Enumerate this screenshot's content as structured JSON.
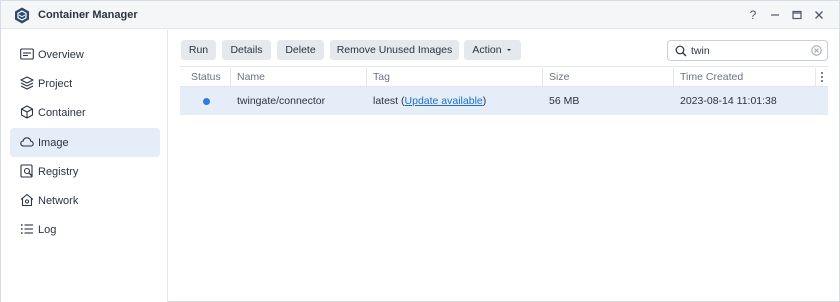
{
  "app": {
    "title": "Container Manager",
    "controls": {
      "help": "?",
      "minimize": "—",
      "maximize": "□",
      "close": "✕"
    }
  },
  "sidebar": {
    "items": [
      {
        "label": "Overview",
        "icon": "overview-icon",
        "active": false
      },
      {
        "label": "Project",
        "icon": "project-icon",
        "active": false
      },
      {
        "label": "Container",
        "icon": "container-icon",
        "active": false
      },
      {
        "label": "Image",
        "icon": "cloud-icon",
        "active": true
      },
      {
        "label": "Registry",
        "icon": "registry-icon",
        "active": false
      },
      {
        "label": "Network",
        "icon": "network-icon",
        "active": false
      },
      {
        "label": "Log",
        "icon": "log-icon",
        "active": false
      }
    ]
  },
  "toolbar": {
    "run": "Run",
    "details": "Details",
    "delete": "Delete",
    "remove_unused": "Remove Unused Images",
    "action": "Action",
    "search_value": "twin"
  },
  "table": {
    "columns": [
      "Status",
      "Name",
      "Tag",
      "Size",
      "Time Created"
    ],
    "rows": [
      {
        "status": "running",
        "name": "twingate/connector",
        "tag_prefix": "latest (",
        "tag_link": "Update available",
        "tag_suffix": ")",
        "size": "56 MB",
        "created": "2023-08-14 11:01:38"
      }
    ]
  },
  "colors": {
    "accent": "#2b7fd8",
    "selected_row": "#e4edf8",
    "button_bg": "#e5e8ec",
    "link": "#1f6fc5"
  }
}
